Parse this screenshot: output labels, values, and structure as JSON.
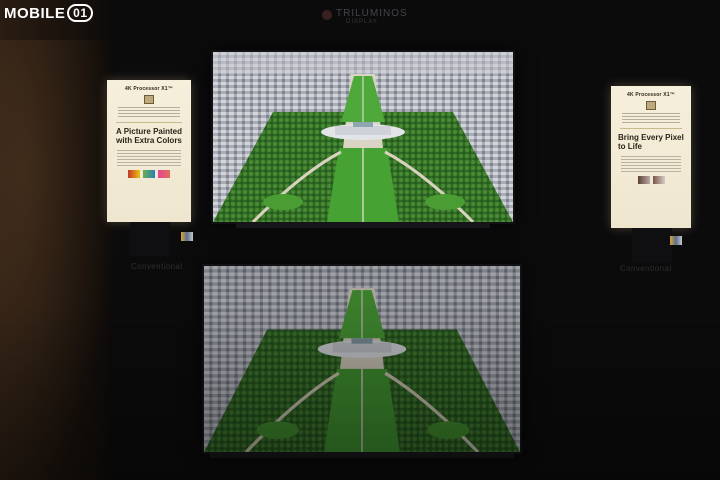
{
  "watermark": {
    "text": "MOBILE",
    "badge": "01"
  },
  "brand": {
    "name": "TRILUMINOS",
    "sub": "DISPLAY"
  },
  "left_card": {
    "label": "4K Processor X1™",
    "headline": "A Picture Painted with Extra Colors"
  },
  "right_card": {
    "label": "4K Processor X1™",
    "headline": "Bring Every Pixel to Life"
  },
  "captions": {
    "left": "Conventional",
    "right": "Conventional"
  },
  "colors": {
    "card_bg": "#f6efdb",
    "screen_grass": "#3f9a34",
    "screen_city": "#b9bcc4"
  }
}
